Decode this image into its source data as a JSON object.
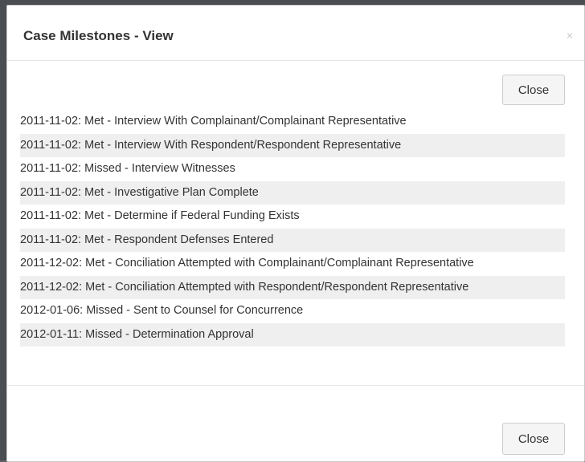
{
  "modal": {
    "title": "Case Milestones - View",
    "close_icon": "×",
    "close_icon_name": "close-icon"
  },
  "buttons": {
    "top_close": "Close",
    "footer_close": "Close"
  },
  "milestones": [
    "2011-11-02: Met - Interview With Complainant/Complainant Representative",
    "2011-11-02: Met - Interview With Respondent/Respondent Representative",
    "2011-11-02: Missed - Interview Witnesses",
    "2011-11-02: Met - Investigative Plan Complete",
    "2011-11-02: Met - Determine if Federal Funding Exists",
    "2011-11-02: Met - Respondent Defenses Entered",
    "2011-12-02: Met - Conciliation Attempted with Complainant/Complainant Representative",
    "2011-12-02: Met - Conciliation Attempted with Respondent/Respondent Representative",
    "2012-01-06: Missed - Sent to Counsel for Concurrence",
    "2012-01-11: Missed - Determination Approval"
  ],
  "colors": {
    "stripe": "#efefef",
    "text": "#333333",
    "backdrop": "#4a4d52"
  }
}
